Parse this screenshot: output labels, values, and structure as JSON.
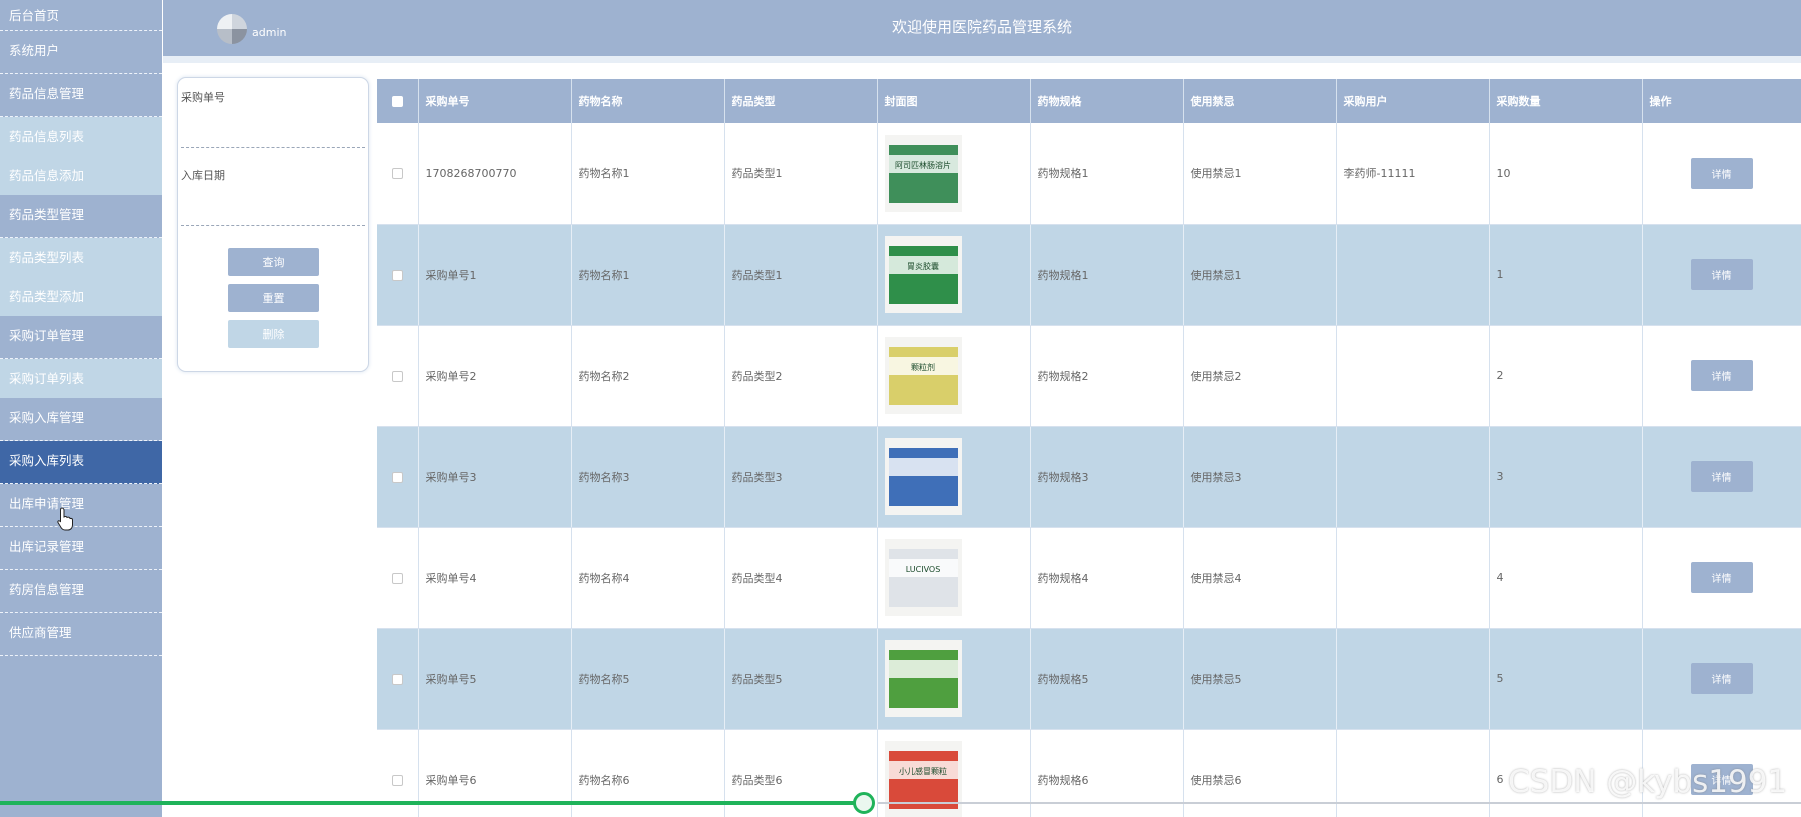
{
  "header": {
    "username": "admin",
    "title": "欢迎使用医院药品管理系统"
  },
  "sidebar": {
    "items": [
      {
        "label": "后台首页",
        "kind": "top"
      },
      {
        "label": "系统用户",
        "kind": "main"
      },
      {
        "label": "药品信息管理",
        "kind": "main"
      },
      {
        "label": "药品信息列表",
        "kind": "sub"
      },
      {
        "label": "药品信息添加",
        "kind": "sub"
      },
      {
        "label": "药品类型管理",
        "kind": "main"
      },
      {
        "label": "药品类型列表",
        "kind": "sub"
      },
      {
        "label": "药品类型添加",
        "kind": "sub"
      },
      {
        "label": "采购订单管理",
        "kind": "main"
      },
      {
        "label": "采购订单列表",
        "kind": "sub"
      },
      {
        "label": "采购入库管理",
        "kind": "main"
      },
      {
        "label": "采购入库列表",
        "kind": "active"
      },
      {
        "label": "出库申请管理",
        "kind": "main"
      },
      {
        "label": "出库记录管理",
        "kind": "main"
      },
      {
        "label": "药房信息管理",
        "kind": "main"
      },
      {
        "label": "供应商管理",
        "kind": "main"
      }
    ]
  },
  "search": {
    "field1_label": "采购单号",
    "field1_value": "",
    "field2_label": "入库日期",
    "field2_value": "",
    "query_label": "查询",
    "reset_label": "重置",
    "delete_label": "删除"
  },
  "table": {
    "columns": [
      "采购单号",
      "药物名称",
      "药品类型",
      "封面图",
      "药物规格",
      "使用禁忌",
      "采购用户",
      "采购数量",
      "操作"
    ],
    "rows": [
      {
        "order_no": "1708268700770",
        "name": "药物名称1",
        "type": "药品类型1",
        "spec": "药物规格1",
        "taboo": "使用禁忌1",
        "user": "李药师-11111",
        "qty": "10",
        "action": "详情"
      },
      {
        "order_no": "采购单号1",
        "name": "药物名称1",
        "type": "药品类型1",
        "spec": "药物规格1",
        "taboo": "使用禁忌1",
        "user": "",
        "qty": "1",
        "action": "详情"
      },
      {
        "order_no": "采购单号2",
        "name": "药物名称2",
        "type": "药品类型2",
        "spec": "药物规格2",
        "taboo": "使用禁忌2",
        "user": "",
        "qty": "2",
        "action": "详情"
      },
      {
        "order_no": "采购单号3",
        "name": "药物名称3",
        "type": "药品类型3",
        "spec": "药物规格3",
        "taboo": "使用禁忌3",
        "user": "",
        "qty": "3",
        "action": "详情"
      },
      {
        "order_no": "采购单号4",
        "name": "药物名称4",
        "type": "药品类型4",
        "spec": "药物规格4",
        "taboo": "使用禁忌4",
        "user": "",
        "qty": "4",
        "action": "详情"
      },
      {
        "order_no": "采购单号5",
        "name": "药物名称5",
        "type": "药品类型5",
        "spec": "药物规格5",
        "taboo": "使用禁忌5",
        "user": "",
        "qty": "5",
        "action": "详情"
      },
      {
        "order_no": "采购单号6",
        "name": "药物名称6",
        "type": "药品类型6",
        "spec": "药物规格6",
        "taboo": "使用禁忌6",
        "user": "",
        "qty": "6",
        "action": "详情"
      }
    ],
    "cover_colors": [
      "#3f8f5a",
      "#2f8f4a",
      "#d9cf6a",
      "#3f6fb8",
      "#dfe3e8",
      "#4f9f3f",
      "#d94a3a"
    ]
  },
  "cover_labels": [
    "阿司匹林肠溶片",
    "胃炎胶囊",
    "颗粒剂",
    "",
    "LUCIVOS",
    "",
    "小儿感冒颗粒"
  ],
  "progress": {
    "fraction": 0.48
  },
  "watermark": "CSDN @kybs1991",
  "colors": {
    "accent": "#9eb2d0",
    "active": "#3f67a6",
    "sub": "#c0d6e6",
    "progress": "#1fb35a"
  }
}
